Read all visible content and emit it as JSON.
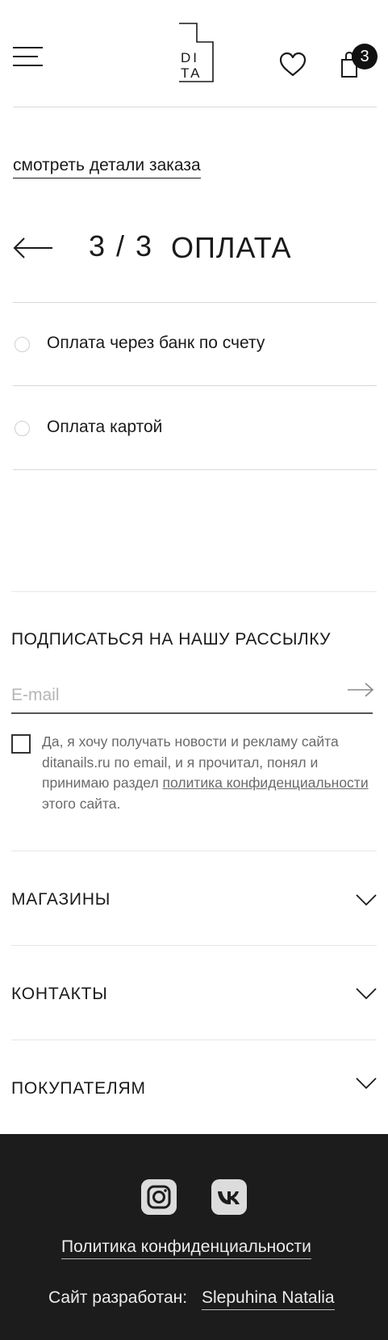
{
  "header": {
    "logo_line1": "DI",
    "logo_line2": "TA",
    "cart_count": "3"
  },
  "order": {
    "details_link": "смотреть детали заказа",
    "step": "3 / 3",
    "step_title": "ОПЛАТА"
  },
  "payment_options": [
    {
      "label": "Оплата через банк по счету"
    },
    {
      "label": "Оплата картой"
    }
  ],
  "newsletter": {
    "title": "ПОДПИСАТЬСЯ НА НАШУ РАССЫЛКУ",
    "email_placeholder": "E-mail",
    "consent_text_1": "Да, я хочу получать новости и рекламу сайта ditanails.ru по email, и я прочитал, понял и принимаю раздел ",
    "consent_link": "политика конфиденциальности",
    "consent_text_2": " этого сайта."
  },
  "accordion": [
    {
      "title": "МАГАЗИНЫ"
    },
    {
      "title": "КОНТАКТЫ"
    },
    {
      "title": "ПОКУПАТЕЛЯМ"
    }
  ],
  "footer": {
    "privacy_link": "Политика конфиденциальности",
    "developed_label": "Сайт разработан:",
    "developer_link": "Slepuhina Natalia"
  },
  "colors": {
    "footer_bg": "#1c1c1c",
    "text": "#1a1a1a",
    "divider": "#d8d8d8"
  }
}
